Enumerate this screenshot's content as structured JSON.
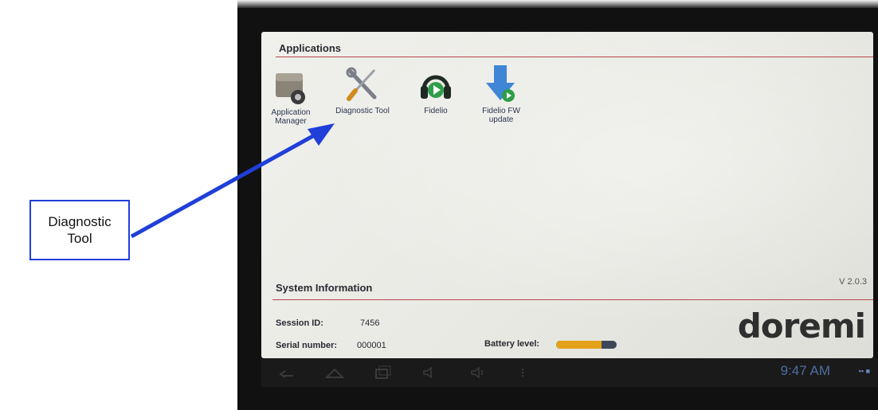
{
  "applications": {
    "title": "Applications",
    "items": [
      {
        "label": "Application Manager",
        "icon": "application-manager-icon"
      },
      {
        "label": "Diagnostic Tool",
        "icon": "wrench-screwdriver-icon"
      },
      {
        "label": "Fidelio",
        "icon": "headphones-play-icon"
      },
      {
        "label": "Fidelio FW update",
        "icon": "download-arrow-icon"
      }
    ]
  },
  "system_info": {
    "title": "System Information",
    "version": "V 2.0.3",
    "session_label": "Session ID:",
    "session_value": "7456",
    "serial_label": "Serial number:",
    "serial_value": "000001",
    "battery_label": "Battery level:",
    "battery_fraction": 0.75
  },
  "brand": "doremi",
  "system_bar": {
    "clock": "9:47 AM",
    "nav_buttons": [
      "back-icon",
      "home-icon",
      "recent-apps-icon",
      "volume-down-icon",
      "volume-up-icon",
      "menu-icon"
    ]
  },
  "callout": {
    "label": "Diagnostic Tool"
  },
  "colors": {
    "callout_blue": "#1f3fd8",
    "divider_red": "#b8464a",
    "battery_fill": "#e3a21a",
    "clock_blue": "#4a6fa0"
  }
}
